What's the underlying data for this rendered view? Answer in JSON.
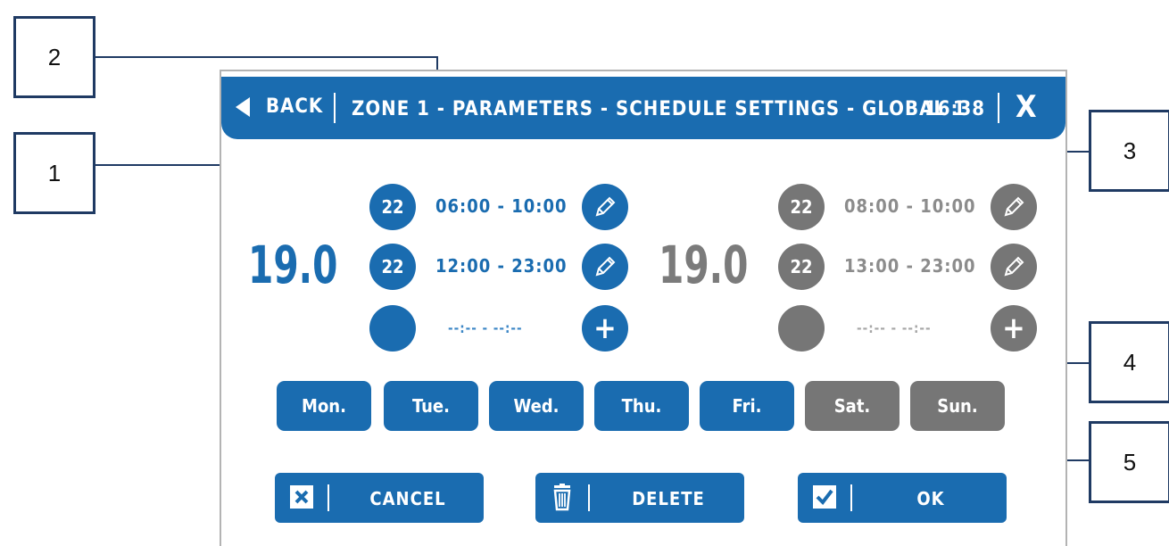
{
  "callouts": [
    "1",
    "2",
    "3",
    "4",
    "5"
  ],
  "header": {
    "back_label": "BACK",
    "title": "ZONE 1 - PARAMETERS - SCHEDULE SETTINGS - GLOBAL 1",
    "time": "16:38",
    "close_symbol": "X"
  },
  "left_schedule": {
    "temperature": "19.0",
    "intervals": [
      {
        "setpoint": "22",
        "time": "06:00 - 10:00",
        "icon": "pencil-icon"
      },
      {
        "setpoint": "22",
        "time": "12:00 - 23:00",
        "icon": "pencil-icon"
      },
      {
        "setpoint": "",
        "time": "--:-- - --:--",
        "icon": "plus-icon"
      }
    ]
  },
  "right_schedule": {
    "temperature": "19.0",
    "intervals": [
      {
        "setpoint": "22",
        "time": "08:00 - 10:00",
        "icon": "pencil-icon"
      },
      {
        "setpoint": "22",
        "time": "13:00 - 23:00",
        "icon": "pencil-icon"
      },
      {
        "setpoint": "",
        "time": "--:-- - --:--",
        "icon": "plus-icon"
      }
    ]
  },
  "days": [
    {
      "label": "Mon.",
      "state": "blue"
    },
    {
      "label": "Tue.",
      "state": "blue"
    },
    {
      "label": "Wed.",
      "state": "blue"
    },
    {
      "label": "Thu.",
      "state": "blue"
    },
    {
      "label": "Fri.",
      "state": "blue"
    },
    {
      "label": "Sat.",
      "state": "gray"
    },
    {
      "label": "Sun.",
      "state": "gray"
    }
  ],
  "actions": {
    "cancel": "CANCEL",
    "delete": "DELETE",
    "ok": "OK"
  },
  "colors": {
    "primary": "#1a6cb0",
    "secondary": "#767676",
    "callout_line": "#1f3a63"
  }
}
